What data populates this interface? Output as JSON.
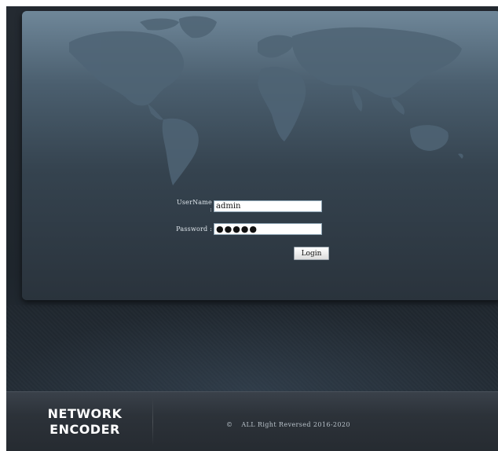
{
  "login": {
    "username_label": "UserName :",
    "username_value": "admin",
    "password_label": "Password :",
    "password_value": "●●●●●",
    "login_button": "Login"
  },
  "footer": {
    "brand_line1": "NETWORK",
    "brand_line2": "ENCODER",
    "copyright_symbol": "©",
    "copyright_text": "ALL Right Reversed 2016-2020"
  },
  "colors": {
    "panel_top": "#6f8799",
    "panel_bottom": "#2a333c",
    "frame": "#242a31",
    "footer": "#2c3239"
  }
}
